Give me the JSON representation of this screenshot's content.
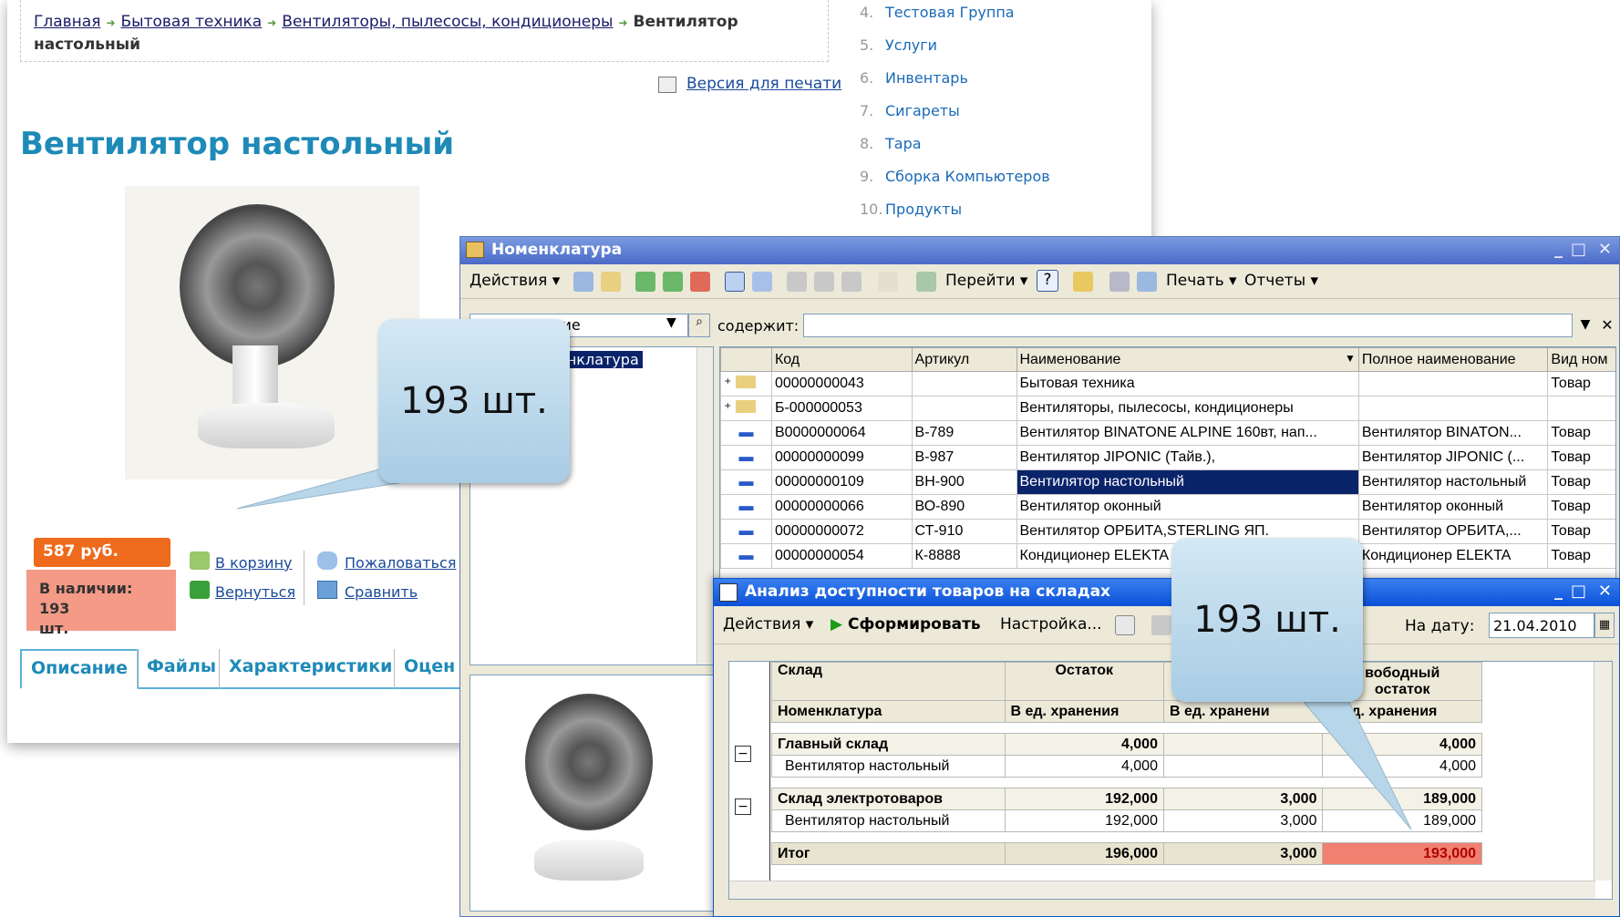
{
  "web": {
    "breadcrumbs": [
      "Главная",
      "Бытовая техника",
      "Вентиляторы, пылесосы, кондиционеры"
    ],
    "breadcrumb_current_1": "Вентилятор",
    "breadcrumb_current_2": "настольный",
    "print_version": "Версия для печати",
    "title": "Вентилятор настольный",
    "price": "587 руб.",
    "stock_line1": "В наличии: 193",
    "stock_line2": "шт.",
    "link_cart": "В корзину",
    "link_complain": "Пожаловаться",
    "link_back": "Вернуться",
    "link_compare": "Сравнить",
    "tabs": [
      "Описание",
      "Файлы",
      "Характеристики",
      "Оцен"
    ],
    "accent": "#1e8ab8"
  },
  "catalog_list": [
    {
      "n": "4.",
      "t": "Тестовая Группа"
    },
    {
      "n": "5.",
      "t": "Услуги"
    },
    {
      "n": "6.",
      "t": "Инвентарь"
    },
    {
      "n": "7.",
      "t": "Сигареты"
    },
    {
      "n": "8.",
      "t": "Тара"
    },
    {
      "n": "9.",
      "t": "Сборка Компьютеров"
    },
    {
      "n": "10.",
      "t": "Продукты"
    }
  ],
  "win1": {
    "title": "Номенклатура",
    "actions": "Действия",
    "goto": "Перейти",
    "help": "?",
    "print": "Печать",
    "reports": "Отчеты",
    "filter_field": "ние",
    "contains_label": "содержит:",
    "tree_item": "енклатура",
    "columns": [
      "Код",
      "Артикул",
      "Наименование",
      "Полное наименование",
      "Вид ном"
    ],
    "rows": [
      {
        "code": "00000000043",
        "art": "",
        "name": "Бытовая техника",
        "full": "",
        "kind": "Товар",
        "folder": true
      },
      {
        "code": "Б-000000053",
        "art": "",
        "name": "Вентиляторы, пылесосы, кондиционеры",
        "full": "",
        "kind": "",
        "folder": true
      },
      {
        "code": "В0000000064",
        "art": "В-789",
        "name": "Вентилятор BINATONE ALPINE 160вт, нап...",
        "full": "Вентилятор BINATON...",
        "kind": "Товар",
        "folder": false
      },
      {
        "code": "00000000099",
        "art": "В-987",
        "name": "Вентилятор JIPONIC (Тайв.),",
        "full": "Вентилятор JIPONIC (...",
        "kind": "Товар",
        "folder": false
      },
      {
        "code": "00000000109",
        "art": "ВН-900",
        "name": "Вентилятор настольный",
        "full": "Вентилятор настольный",
        "kind": "Товар",
        "folder": false,
        "selected": true
      },
      {
        "code": "00000000066",
        "art": "ВО-890",
        "name": "Вентилятор оконный",
        "full": "Вентилятор оконный",
        "kind": "Товар",
        "folder": false
      },
      {
        "code": "00000000072",
        "art": "СТ-910",
        "name": "Вентилятор ОРБИТА,STERLING ЯП.",
        "full": "Вентилятор ОРБИТА,...",
        "kind": "Товар",
        "folder": false
      },
      {
        "code": "00000000054",
        "art": "К-8888",
        "name": "Кондиционер ELEKTA",
        "full": "Кондиционер ELEKTA",
        "kind": "Товар",
        "folder": false
      }
    ]
  },
  "win2": {
    "title": "Анализ доступности товаров на складах",
    "actions": "Действия",
    "generate": "Сформировать",
    "settings": "Настройка...",
    "date_label": "На дату:",
    "date_value": "21.04.2010",
    "head": {
      "warehouse": "Склад",
      "balance": "Остаток",
      "free1": "вободный",
      "free2": "остаток",
      "nomen": "Номенклатура",
      "unit1": "В ед. хранения",
      "unit2": "В ед. хранени",
      "unit3": "В ед. хранения"
    },
    "groups": [
      {
        "name": "Главный склад",
        "bal": "4,000",
        "res": "",
        "free": "4,000",
        "item": "Вентилятор настольный",
        "ibal": "4,000",
        "ires": "",
        "ifree": "4,000"
      },
      {
        "name": "Склад электротоваров",
        "bal": "192,000",
        "res": "3,000",
        "free": "189,000",
        "item": "Вентилятор настольный",
        "ibal": "192,000",
        "ires": "3,000",
        "ifree": "189,000"
      }
    ],
    "total": {
      "label": "Итог",
      "bal": "196,000",
      "res": "3,000",
      "free": "193,000"
    },
    "highlight": "#f08070"
  },
  "callouts": [
    "193 шт.",
    "193 шт."
  ]
}
